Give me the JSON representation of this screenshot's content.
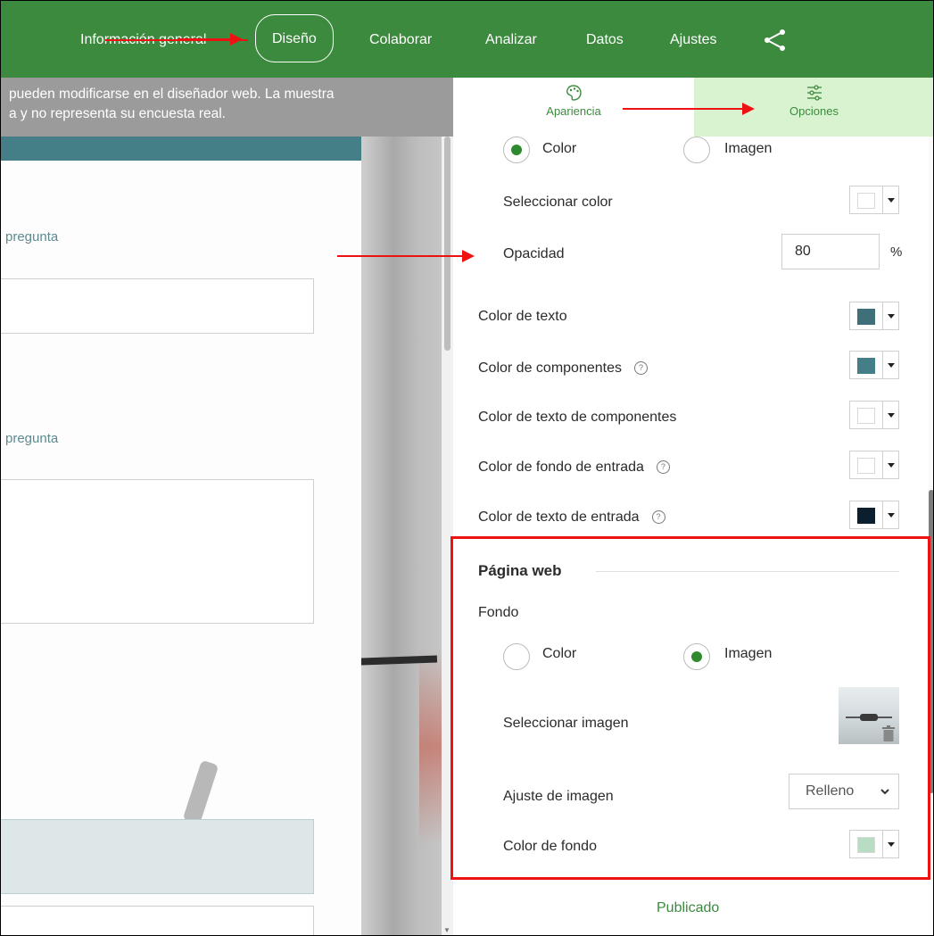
{
  "nav": {
    "items": [
      "Información general",
      "Diseño",
      "Colaborar",
      "Analizar",
      "Datos",
      "Ajustes"
    ],
    "active": "Diseño",
    "share_icon": "share-icon"
  },
  "preview": {
    "notice_line1": "pueden modificarse en el diseñador web. La muestra",
    "notice_line2": "a y no representa su encuesta real.",
    "question1_label": "pregunta",
    "question2_label": "pregunta"
  },
  "panel": {
    "tabs": [
      {
        "label": "Apariencia",
        "icon": "palette-icon"
      },
      {
        "label": "Opciones",
        "icon": "sliders-icon"
      }
    ],
    "active_tab": "Opciones",
    "header_background": {
      "color_option": "Color",
      "image_option": "Imagen",
      "selected": "Color",
      "select_color_label": "Seleccionar color",
      "opacity_label": "Opacidad",
      "opacity_value": "80",
      "opacity_unit": "%"
    },
    "colors": [
      {
        "label": "Color de texto",
        "value": "#3f6f78",
        "help": false
      },
      {
        "label": "Color de componentes",
        "value": "#447e86",
        "help": true
      },
      {
        "label": "Color de texto de componentes",
        "value": "#ffffff",
        "help": false
      },
      {
        "label": "Color de fondo de entrada",
        "value": "#ffffff",
        "help": true
      },
      {
        "label": "Color de texto de entrada",
        "value": "#0b1f2e",
        "help": true
      }
    ],
    "web_page": {
      "title": "Página web",
      "background_label": "Fondo",
      "color_option": "Color",
      "image_option": "Imagen",
      "selected": "Imagen",
      "select_image_label": "Seleccionar imagen",
      "image_fit_label": "Ajuste de imagen",
      "image_fit_value": "Relleno",
      "bg_color_label": "Color de fondo",
      "bg_color_value": "#b9dcc4"
    },
    "status": "Publicado",
    "select_color_swatch": "#ffffff"
  },
  "colors": {
    "brand_green": "#3b8a3e",
    "annotation_red": "#e11111",
    "tab_active_bg": "#d9f2cf"
  }
}
